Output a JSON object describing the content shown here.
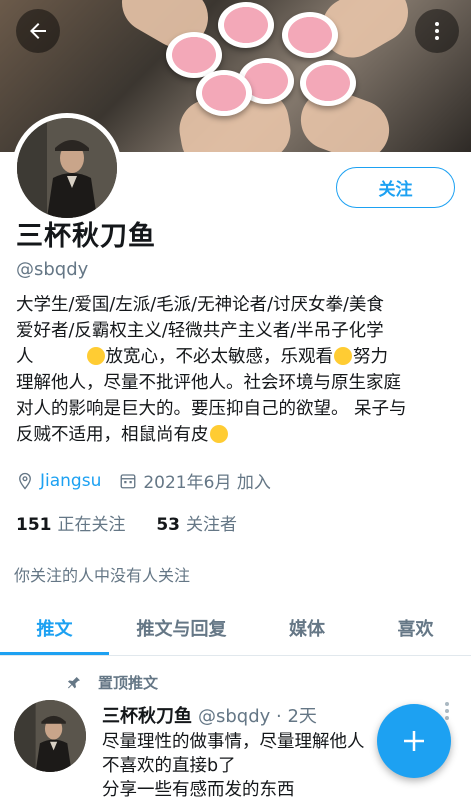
{
  "header": {
    "back_icon": "arrow-left-icon",
    "more_icon": "more-vertical-icon"
  },
  "profile": {
    "name": "三杯秋刀鱼",
    "handle": "@sbqdy",
    "follow_label": "关注",
    "bio_lines": [
      "大学生/爱国/左派/毛派/无神论者/讨厌女拳/美食",
      "爱好者/反霸权主义/轻微共产主义者/半吊子化学",
      [
        "人",
        "放宽心，不必太敏感，乐观看",
        "努力"
      ],
      "理解他人，尽量不批评他人。社会环境与原生家庭",
      "对人的影响是巨大的。要压抑自己的欲望。 呆子与",
      "反贼不适用，相鼠尚有皮"
    ],
    "location": "Jiangsu",
    "joined": "2021年6月 加入",
    "following_count": "151",
    "following_label": "正在关注",
    "followers_count": "53",
    "followers_label": "关注者",
    "common_followers": "你关注的人中没有人关注"
  },
  "tabs": [
    {
      "label": "推文",
      "active": true
    },
    {
      "label": "推文与回复",
      "active": false
    },
    {
      "label": "媒体",
      "active": false
    },
    {
      "label": "喜欢",
      "active": false
    }
  ],
  "tweet": {
    "pinned_label": "置顶推文",
    "author_name": "三杯秋刀鱼",
    "author_handle": "@sbqdy · 2天",
    "lines": [
      "尽量理性的做事情，尽量理解他人",
      "不喜欢的直接b了",
      "分享一些有感而发的东西"
    ]
  },
  "fab_icon": "plus-icon",
  "colors": {
    "accent": "#1da1f2",
    "text": "#14171a",
    "secondary": "#657786"
  }
}
